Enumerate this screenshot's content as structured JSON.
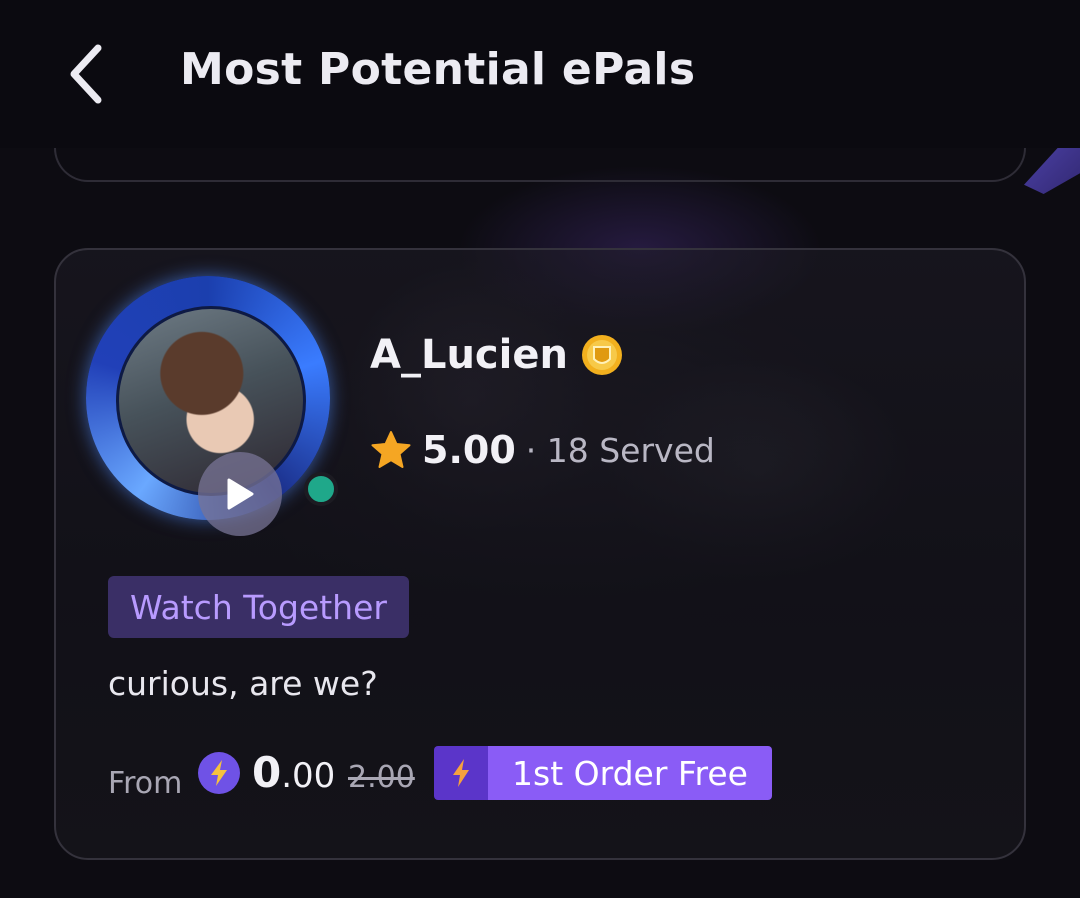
{
  "header": {
    "title": "Most Potential ePals"
  },
  "epal": {
    "name": "A_Lucien",
    "rating": "5.00",
    "served": "· 18 Served",
    "tag": "Watch Together",
    "bio": "curious, are we?",
    "price": {
      "from_label": "From",
      "current_whole": "0",
      "current_decimals": ".00",
      "original": "2.00",
      "promo": "1st Order Free"
    }
  },
  "colors": {
    "background": "#0d0c12",
    "accent": "#8a5cf6",
    "tag_text": "#b89bff",
    "online": "#1fa88a",
    "star": "#f5a623"
  },
  "icons": [
    "back-arrow-icon",
    "vip-badge-icon",
    "star-icon",
    "play-icon",
    "lightning-coin-icon",
    "lightning-icon"
  ]
}
